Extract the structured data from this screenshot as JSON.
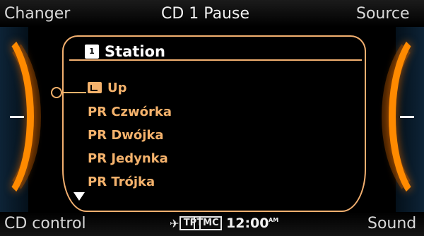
{
  "header": {
    "left_softkey": "Changer",
    "status": "CD 1 Pause",
    "right_softkey": "Source"
  },
  "list": {
    "title": "Station",
    "title_icon": "folder-icon",
    "items": [
      {
        "label": "Up",
        "icon": "folder-up-icon"
      },
      {
        "label": "PR Czwórka"
      },
      {
        "label": "PR Dwójka"
      },
      {
        "label": "PR Jedynka"
      },
      {
        "label": "PR Trójka"
      }
    ]
  },
  "footer": {
    "left_softkey": "CD control",
    "tp_badge": "TP",
    "tmc_badge": "TMC",
    "time": "12:00",
    "time_suffix": "AM",
    "right_softkey": "Sound"
  },
  "colors": {
    "accent_orange": "#f4b26c",
    "arc_orange": "#ff8a00",
    "background": "#000000"
  }
}
